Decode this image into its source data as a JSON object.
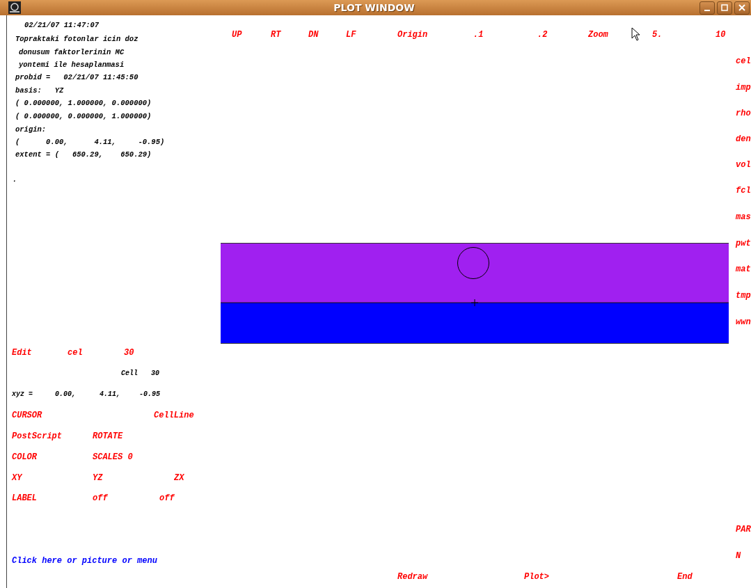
{
  "window": {
    "title": "PLOT WINDOW"
  },
  "header_lines": [
    "02/21/07 11:47:07",
    "Topraktaki fotonlar icin doz",
    "donusum faktorlerinin MC",
    "yontemi ile hesaplanmasi",
    "probid =   02/21/07 11:45:50",
    "basis:   YZ",
    "( 0.000000, 1.000000, 0.000000)",
    "( 0.000000, 0.000000, 1.000000)",
    "origin:",
    "(      0.00,      4.11,     -0.95)",
    "extent = (   650.29,    650.29)",
    "."
  ],
  "top_menu": [
    "UP",
    "RT",
    "DN",
    "LF",
    "Origin",
    ".1",
    ".2",
    "Zoom",
    "5.",
    "10"
  ],
  "side_menu": [
    "cel",
    "imp",
    "rho",
    "den",
    "vol",
    "fcl",
    "mas",
    "pwt",
    "mat",
    "tmp",
    "wwn"
  ],
  "side_menu_lower": [
    "PAR",
    "N"
  ],
  "edit": {
    "label": "Edit",
    "parameter": "cel",
    "value": "30"
  },
  "cell_info": {
    "label": "Cell",
    "value": "30"
  },
  "xyz": {
    "label": "xyz =",
    "values": [
      "0.00,",
      "4.11,",
      "-0.95"
    ]
  },
  "controls": [
    [
      "CURSOR",
      "CellLine"
    ],
    [
      "PostScript",
      "ROTATE"
    ],
    [
      "COLOR",
      "SCALES 0"
    ],
    [
      "XY",
      "YZ",
      "ZX"
    ],
    [
      "LABEL",
      "off",
      "off"
    ]
  ],
  "prompt": "Click here or picture or menu",
  "bottom_menu": [
    "Redraw",
    "Plot>",
    "End"
  ],
  "plot": {
    "regions": [
      {
        "color": "#a020f0"
      },
      {
        "color": "#0000ff"
      }
    ]
  }
}
